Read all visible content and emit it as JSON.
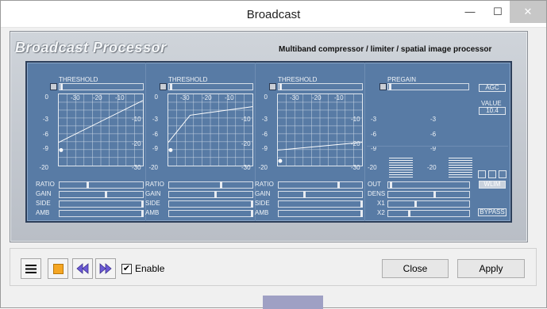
{
  "window": {
    "title": "Broadcast",
    "minimize_glyph": "—",
    "maximize_glyph": "☐",
    "close_glyph": "✕"
  },
  "plugin": {
    "title": "Broadcast Processor",
    "subtitle": "Multiband compressor / limiter / spatial image processor"
  },
  "bands": [
    {
      "threshold_label": "THRESHOLD",
      "x_ticks": [
        "-30",
        "-20",
        "-10"
      ],
      "y_ticks": [
        "0",
        "-3",
        "-6",
        "-9",
        "-20"
      ],
      "right_ticks": [
        "-10",
        "-20",
        "-30"
      ],
      "sliders": [
        {
          "label": "RATIO",
          "value": 0.33
        },
        {
          "label": "GAIN",
          "value": 0.55
        },
        {
          "label": "SIDE",
          "value": 1
        },
        {
          "label": "AMB",
          "value": 1
        }
      ]
    },
    {
      "threshold_label": "THRESHOLD",
      "x_ticks": [
        "-30",
        "-20",
        "-10"
      ],
      "y_ticks": [
        "0",
        "-3",
        "-6",
        "-9",
        "-20"
      ],
      "right_ticks": [
        "-10",
        "-20",
        "-30"
      ],
      "sliders": [
        {
          "label": "RATIO",
          "value": 0.62
        },
        {
          "label": "GAIN",
          "value": 0.55
        },
        {
          "label": "SIDE",
          "value": 1
        },
        {
          "label": "AMB",
          "value": 1
        }
      ]
    },
    {
      "threshold_label": "THRESHOLD",
      "x_ticks": [
        "-30",
        "-20",
        "-10"
      ],
      "y_ticks": [
        "0",
        "-3",
        "-6",
        "-9",
        "-20"
      ],
      "right_ticks": [
        "-10",
        "-20",
        "-30"
      ],
      "sliders": [
        {
          "label": "RATIO",
          "value": 0.72
        },
        {
          "label": "GAIN",
          "value": 0.3
        },
        {
          "label": "SIDE",
          "value": 1
        },
        {
          "label": "AMB",
          "value": 1
        }
      ]
    }
  ],
  "output": {
    "pregain_label": "PREGAIN",
    "left_ticks": [
      "-3",
      "-6",
      "-9",
      "-20"
    ],
    "mid_ticks": [
      "-3",
      "-6",
      "-9",
      "-20"
    ],
    "agc_label": "AGC",
    "value_label": "VALUE",
    "value": "10.4",
    "wlim_label": "WLIM",
    "bypass_label": "BYPASS",
    "sliders": [
      {
        "label": "OUT",
        "value": 0.02
      },
      {
        "label": "DENS",
        "value": 0.57
      },
      {
        "label": "X1",
        "value": 0.33
      },
      {
        "label": "X2",
        "value": 0.25
      }
    ]
  },
  "footer": {
    "enable_label": "Enable",
    "enable_checked": "✔",
    "close_label": "Close",
    "apply_label": "Apply"
  },
  "colors": {
    "panel": "#587ba5",
    "accent_stop": "#f5a623",
    "arrow": "#6b5ad6"
  }
}
